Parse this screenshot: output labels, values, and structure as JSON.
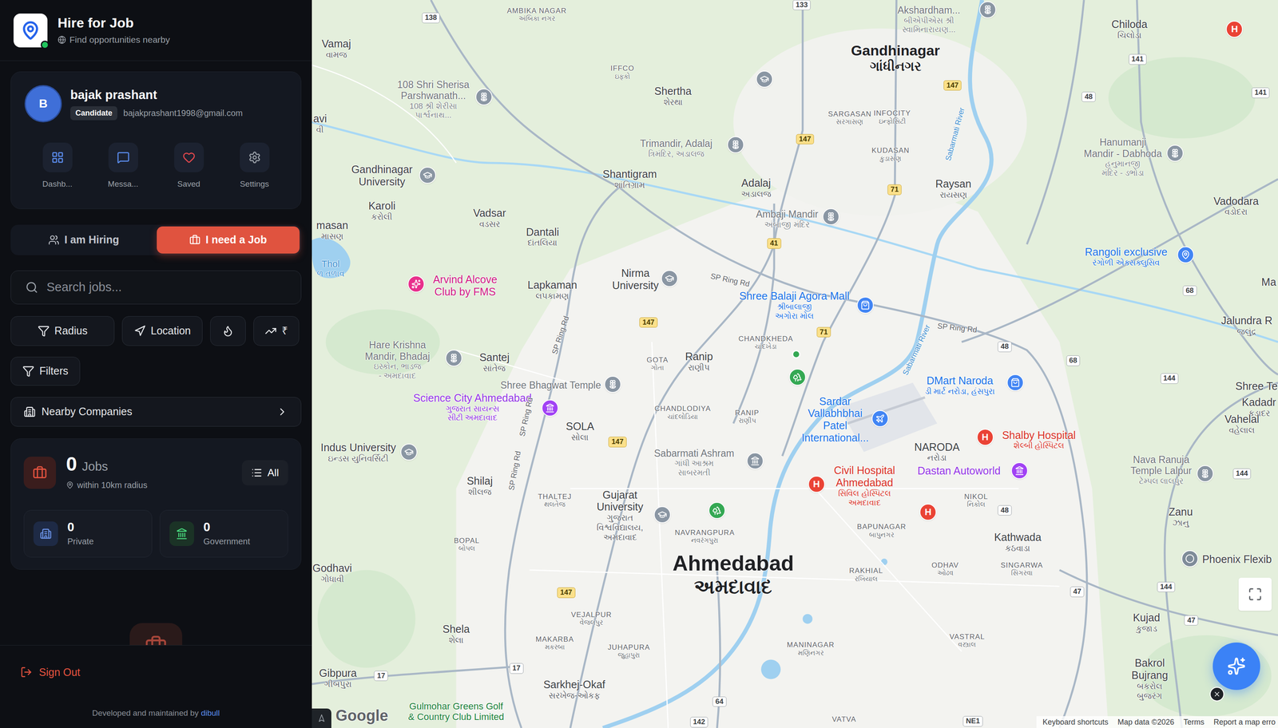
{
  "app": {
    "title": "Hire for Job",
    "subtitle": "Find opportunities nearby",
    "online": true
  },
  "profile": {
    "initial": "B",
    "name": "bajak prashant",
    "role": "Candidate",
    "email": "bajakprashant1998@gmail.com"
  },
  "quick_actions": [
    {
      "kind": "dashboard",
      "label": "Dashb..."
    },
    {
      "kind": "messages",
      "label": "Messa..."
    },
    {
      "kind": "saved",
      "label": "Saved"
    },
    {
      "kind": "settings",
      "label": "Settings"
    }
  ],
  "mode_toggle": [
    {
      "kind": "hiring",
      "label": "I am Hiring",
      "selected": false
    },
    {
      "kind": "job",
      "label": "I need a Job",
      "selected": true
    }
  ],
  "search": {
    "placeholder": "Search jobs..."
  },
  "filter_chips": [
    {
      "kind": "radius",
      "label": "Radius"
    },
    {
      "kind": "location",
      "label": "Location"
    },
    {
      "kind": "hot"
    },
    {
      "kind": "trend",
      "label": "₹"
    }
  ],
  "filters_button": {
    "label": "Filters"
  },
  "nearby_companies": {
    "label": "Nearby Companies"
  },
  "jobs_summary": {
    "count": "0",
    "unit": "Jobs",
    "radius": "within 10km radius",
    "view": "All",
    "breakdown": [
      {
        "kind": "private",
        "count": "0",
        "label": "Private"
      },
      {
        "kind": "government",
        "count": "0",
        "label": "Government"
      }
    ]
  },
  "footer": {
    "sign_out": "Sign Out",
    "credit": "Developed and maintained by",
    "credit_link": "dibull"
  },
  "map": {
    "labels": [
      {
        "kind": "area",
        "text": [
          "AMBIKA NAGAR"
        ],
        "sub": [
          "અંબિકા નગર"
        ]
      },
      {
        "kind": "town",
        "text": [
          "Vamaj"
        ],
        "sub": [
          "વામજ"
        ]
      },
      {
        "kind": "poi",
        "text": [
          "108 Shri Sherisa",
          "Parshwanath..."
        ],
        "sub": [
          "108 શ્રી શેરીસા",
          "પાર્શ્વનાથ..."
        ]
      },
      {
        "kind": "town",
        "text": [
          "Shertha"
        ],
        "sub": [
          "શેરથા"
        ]
      },
      {
        "kind": "area",
        "text": [
          "IFFCO"
        ],
        "sub": [
          "ઇફ્કો"
        ]
      },
      {
        "kind": "city",
        "text": [
          "Gandhinagar"
        ],
        "sub": [
          "ગાંધીનગર"
        ]
      },
      {
        "kind": "poi",
        "text": [
          "Akshardham..."
        ],
        "sub": [
          "બીએપીએસ શ્રી",
          "સ્વામિનારાયણ..."
        ]
      },
      {
        "kind": "town",
        "text": [
          "Chiloda"
        ],
        "sub": [
          "ચિલોડા"
        ]
      },
      {
        "kind": "area",
        "text": [
          "SARGASAN"
        ],
        "sub": [
          "સરગાસણ"
        ]
      },
      {
        "kind": "area",
        "text": [
          "INFOCITY"
        ],
        "sub": [
          "ઇન્ફોસિટી"
        ]
      },
      {
        "kind": "poi",
        "text": [
          "Trimandir, Adalaj"
        ],
        "sub": [
          "ત્રિમંદિર, અડાલજ"
        ]
      },
      {
        "kind": "area",
        "text": [
          "KUDASAN"
        ],
        "sub": [
          "કુડાસણ"
        ]
      },
      {
        "kind": "poi",
        "text": [
          "Hanumanji",
          "Mandir - Dabhoda"
        ],
        "sub": [
          "હનુમાનજી",
          "મંદિર - ડભોડા"
        ]
      },
      {
        "kind": "town",
        "text": [
          "Gandhinagar",
          "University"
        ],
        "sub": []
      },
      {
        "kind": "town",
        "text": [
          "avi"
        ],
        "sub": [
          "વી"
        ]
      },
      {
        "kind": "town",
        "text": [
          "Shantigram"
        ],
        "sub": [
          "શાંતિગ્રામ"
        ]
      },
      {
        "kind": "town",
        "text": [
          "Adalaj"
        ],
        "sub": [
          "અડાલજ"
        ]
      },
      {
        "kind": "town",
        "text": [
          "Raysan"
        ],
        "sub": [
          "રાયસણ"
        ]
      },
      {
        "kind": "town",
        "text": [
          "Vadodara"
        ],
        "sub": [
          "વડોદરા"
        ]
      },
      {
        "kind": "poi",
        "text": [
          "Ambaji Mandir"
        ],
        "sub": [
          "અંબાજી મંદિર"
        ]
      },
      {
        "kind": "town",
        "text": [
          "Karoli"
        ],
        "sub": [
          "કરોલી"
        ]
      },
      {
        "kind": "town",
        "text": [
          "Vadsar"
        ],
        "sub": [
          "વડસર"
        ]
      },
      {
        "kind": "town",
        "text": [
          "Dantali"
        ],
        "sub": [
          "દાંતલિયા"
        ]
      },
      {
        "kind": "town",
        "text": [
          "masan"
        ],
        "sub": [
          "માસણ"
        ]
      },
      {
        "kind": "water",
        "text": [
          "Thol"
        ],
        "sub": [
          "ળ તળાવ"
        ]
      },
      {
        "kind": "poi-pink",
        "text": [
          "Arvind Alcove",
          "Club by FMS"
        ],
        "sub": []
      },
      {
        "kind": "poi-blue",
        "text": [
          "Rangoli exclusive"
        ],
        "sub": [
          "રંગોળી એક્સક્લુસિવ"
        ]
      },
      {
        "kind": "town",
        "text": [
          "Ma"
        ],
        "sub": []
      },
      {
        "kind": "town",
        "text": [
          "Nirma",
          "University"
        ],
        "sub": []
      },
      {
        "kind": "town",
        "text": [
          "Lapkaman"
        ],
        "sub": [
          "લપકામણ"
        ]
      },
      {
        "kind": "poi-blue",
        "text": [
          "Shree Balaji Agora Mall"
        ],
        "sub": [
          "શ્રીબાલાજી",
          "અગોરા મોલ"
        ]
      },
      {
        "kind": "town",
        "text": [
          "Jalundra R"
        ],
        "sub": [
          "જલુંદ્ર"
        ]
      },
      {
        "kind": "area",
        "text": [
          "CHANDKHEDA"
        ],
        "sub": [
          "ચાંદખેડા"
        ]
      },
      {
        "kind": "poi",
        "text": [
          "Hare Krishna",
          "Mandir, Bhadaj"
        ],
        "sub": [
          "ઇસ્કોન, ભાડજ",
          "- અમદાવાદ"
        ]
      },
      {
        "kind": "town",
        "text": [
          "Santej"
        ],
        "sub": [
          "સાંતેજ"
        ]
      },
      {
        "kind": "area",
        "text": [
          "GOTA"
        ],
        "sub": [
          "ગોતા"
        ]
      },
      {
        "kind": "town",
        "text": [
          "Ranip"
        ],
        "sub": [
          "રાણીપ"
        ]
      },
      {
        "kind": "poi-blue",
        "text": [
          "DMart Naroda"
        ],
        "sub": [
          "ડી માર્ટ નરોડા, હંસપુરા"
        ]
      },
      {
        "kind": "poi",
        "text": [
          "Shree Bhagwat Temple"
        ],
        "sub": []
      },
      {
        "kind": "poi-purple",
        "text": [
          "Science City Ahmedabad"
        ],
        "sub": [
          "ગુજરાત સાયન્સ",
          "સીટી અમદાવાદ"
        ]
      },
      {
        "kind": "poi-blue",
        "text": [
          "Sardar",
          "Vallabhbhai",
          "Patel",
          "International..."
        ],
        "sub": []
      },
      {
        "kind": "area",
        "text": [
          "CHANDLODIYA"
        ],
        "sub": [
          "ચાંદલોડિયા"
        ]
      },
      {
        "kind": "area",
        "text": [
          "RANIP"
        ],
        "sub": [
          "રાણીપ"
        ]
      },
      {
        "kind": "town",
        "text": [
          "SOLA"
        ],
        "sub": [
          "સોલા"
        ]
      },
      {
        "kind": "town",
        "text": [
          "NARODA"
        ],
        "sub": [
          "નરોડા"
        ]
      },
      {
        "kind": "poi-red",
        "text": [
          "Shalby Hospital"
        ],
        "sub": [
          "શેલ્બી હોસ્પિટલ"
        ]
      },
      {
        "kind": "town",
        "text": [
          "Shree Te"
        ],
        "sub": []
      },
      {
        "kind": "town",
        "text": [
          "Kadadr"
        ],
        "sub": [
          "કડાદર"
        ]
      },
      {
        "kind": "town",
        "text": [
          "Vahelal"
        ],
        "sub": [
          "વહેલાલ"
        ]
      },
      {
        "kind": "town",
        "text": [
          "Indus University"
        ],
        "sub": [
          "ઇન્ડસ યુનિવર્સિટી"
        ]
      },
      {
        "kind": "poi",
        "text": [
          "Sabarmati Ashram"
        ],
        "sub": [
          "ગાંધી આશ્રમ",
          "સાબરમતી"
        ]
      },
      {
        "kind": "poi-red",
        "text": [
          "Civil Hospital",
          "Ahmedabad"
        ],
        "sub": [
          "સિવિલ હોસ્પિટલ",
          "અમદાવાદ"
        ]
      },
      {
        "kind": "poi-purple",
        "text": [
          "Dastan Autoworld"
        ],
        "sub": []
      },
      {
        "kind": "poi",
        "text": [
          "Nava Ranuja",
          "Temple Lalpur"
        ],
        "sub": [
          "ટેમ્પલ લાલપુર"
        ]
      },
      {
        "kind": "town",
        "text": [
          "Shilaj"
        ],
        "sub": [
          "શીલજ"
        ]
      },
      {
        "kind": "area",
        "text": [
          "THALTEJ"
        ],
        "sub": [
          "થલતેજ"
        ]
      },
      {
        "kind": "area",
        "text": [
          "NIKOL"
        ],
        "sub": [
          "નિકોલ"
        ]
      },
      {
        "kind": "town",
        "text": [
          "Gujarat",
          "University"
        ],
        "sub": [
          "ગુજરાત",
          "વિશ્વવિદ્યાલય,",
          "અમદાવાદ"
        ]
      },
      {
        "kind": "town",
        "text": [
          "Zanu"
        ],
        "sub": [
          "ઝાનુ"
        ]
      },
      {
        "kind": "area",
        "text": [
          "BAPUNAGAR"
        ],
        "sub": [
          "બાપુનગર"
        ]
      },
      {
        "kind": "area",
        "text": [
          "NAVRANGPURA"
        ],
        "sub": [
          "નવરંગપુરા"
        ]
      },
      {
        "kind": "town",
        "text": [
          "Kathwada"
        ],
        "sub": [
          "કઠવાડા"
        ]
      },
      {
        "kind": "area",
        "text": [
          "BOPAL"
        ],
        "sub": [
          "બોપલ"
        ]
      },
      {
        "kind": "town",
        "text": [
          "Phoenix Flexib"
        ],
        "sub": []
      },
      {
        "kind": "metro",
        "text": [
          "Ahmedabad"
        ],
        "sub": [
          "અમદાવાદ"
        ]
      },
      {
        "kind": "area",
        "text": [
          "ODHAV"
        ],
        "sub": [
          "ઓઢવ"
        ]
      },
      {
        "kind": "area",
        "text": [
          "SINGARWA"
        ],
        "sub": [
          "સિંગરવા"
        ]
      },
      {
        "kind": "area",
        "text": [
          "RAKHIAL"
        ],
        "sub": [
          "રખિયાલ"
        ]
      },
      {
        "kind": "town",
        "text": [
          "Godhavi"
        ],
        "sub": [
          "ગોધાવી"
        ]
      },
      {
        "kind": "area",
        "text": [
          "VEJALPUR"
        ],
        "sub": [
          "વેજલપુર"
        ]
      },
      {
        "kind": "area",
        "text": [
          "MAKARBA"
        ],
        "sub": [
          "મકરબા"
        ]
      },
      {
        "kind": "area",
        "text": [
          "JUHAPURA"
        ],
        "sub": [
          "જુહાપુરા"
        ]
      },
      {
        "kind": "town",
        "text": [
          "Shela"
        ],
        "sub": [
          "શેલા"
        ]
      },
      {
        "kind": "area",
        "text": [
          "MANINAGAR"
        ],
        "sub": [
          "મણિનગર"
        ]
      },
      {
        "kind": "area",
        "text": [
          "VASTRAL"
        ],
        "sub": [
          "વસ્ત્રાલ"
        ]
      },
      {
        "kind": "town",
        "text": [
          "Kujad"
        ],
        "sub": [
          "કુજાડ"
        ]
      },
      {
        "kind": "town",
        "text": [
          "Gibpura"
        ],
        "sub": [
          "ગીબપુરા"
        ]
      },
      {
        "kind": "town",
        "text": [
          "Sarkhej-Okaf"
        ],
        "sub": [
          "સરખેજ-ઓકફ"
        ]
      },
      {
        "kind": "town",
        "text": [
          "Bakrol",
          "Bujrang"
        ],
        "sub": [
          "બકરોલ",
          "બુજરંગ"
        ]
      },
      {
        "kind": "poi-green",
        "text": [
          "Gulmohar Greens Golf",
          "& Country Club Limited"
        ],
        "sub": []
      },
      {
        "kind": "area",
        "text": [
          "VATVA"
        ],
        "sub": []
      },
      {
        "kind": "road",
        "text": [
          "SP Ring Rd"
        ],
        "sub": []
      },
      {
        "kind": "road",
        "text": [
          "SP Ring Rd"
        ],
        "sub": []
      },
      {
        "kind": "road",
        "text": [
          "SP Ring Rd"
        ],
        "sub": []
      },
      {
        "kind": "road",
        "text": [
          "SP Ring Rd"
        ],
        "sub": []
      },
      {
        "kind": "road",
        "text": [
          "SP Ring Rd"
        ],
        "sub": []
      },
      {
        "kind": "river",
        "text": [
          "Sabarmati River"
        ],
        "sub": []
      },
      {
        "kind": "river",
        "text": [
          "Sabarmati River"
        ],
        "sub": []
      }
    ],
    "markers": [
      {
        "kind": "worship"
      },
      {
        "kind": "worship"
      },
      {
        "kind": "worship"
      },
      {
        "kind": "worship"
      },
      {
        "kind": "worship"
      },
      {
        "kind": "worship"
      },
      {
        "kind": "worship"
      },
      {
        "kind": "worship"
      },
      {
        "kind": "school"
      },
      {
        "kind": "school"
      },
      {
        "kind": "school"
      },
      {
        "kind": "school"
      },
      {
        "kind": "school"
      },
      {
        "kind": "hospital",
        "glyph": "H"
      },
      {
        "kind": "hospital",
        "glyph": "H"
      },
      {
        "kind": "hospital",
        "glyph": "H"
      },
      {
        "kind": "hospital",
        "glyph": "H"
      },
      {
        "kind": "shop"
      },
      {
        "kind": "shop"
      },
      {
        "kind": "pin"
      },
      {
        "kind": "venue"
      },
      {
        "kind": "venue"
      },
      {
        "kind": "club"
      },
      {
        "kind": "park"
      },
      {
        "kind": "park"
      },
      {
        "kind": "airport"
      },
      {
        "kind": "museum"
      },
      {
        "kind": "dot"
      },
      {
        "kind": "place"
      }
    ],
    "shields": [
      {
        "kind": "national",
        "label": "138"
      },
      {
        "kind": "national",
        "label": "133"
      },
      {
        "kind": "state",
        "label": "147"
      },
      {
        "kind": "state",
        "label": "147"
      },
      {
        "kind": "national",
        "label": "48"
      },
      {
        "kind": "national",
        "label": "141"
      },
      {
        "kind": "national",
        "label": "141"
      },
      {
        "kind": "state",
        "label": "71"
      },
      {
        "kind": "state",
        "label": "41"
      },
      {
        "kind": "state",
        "label": "147"
      },
      {
        "kind": "state",
        "label": "71"
      },
      {
        "kind": "national",
        "label": "68"
      },
      {
        "kind": "national",
        "label": "48"
      },
      {
        "kind": "national",
        "label": "68"
      },
      {
        "kind": "national",
        "label": "144"
      },
      {
        "kind": "state",
        "label": "147"
      },
      {
        "kind": "national",
        "label": "144"
      },
      {
        "kind": "national",
        "label": "48"
      },
      {
        "kind": "state",
        "label": "147"
      },
      {
        "kind": "national",
        "label": "47"
      },
      {
        "kind": "national",
        "label": "144"
      },
      {
        "kind": "national",
        "label": "47"
      },
      {
        "kind": "national",
        "label": "17"
      },
      {
        "kind": "national",
        "label": "17"
      },
      {
        "kind": "national",
        "label": "64"
      },
      {
        "kind": "national",
        "label": "142"
      },
      {
        "kind": "national",
        "label": "NE1"
      }
    ],
    "logo": "Google",
    "attribution": [
      "Keyboard shortcuts",
      "Map data ©2026",
      "Terms",
      "Report a map erro"
    ]
  }
}
